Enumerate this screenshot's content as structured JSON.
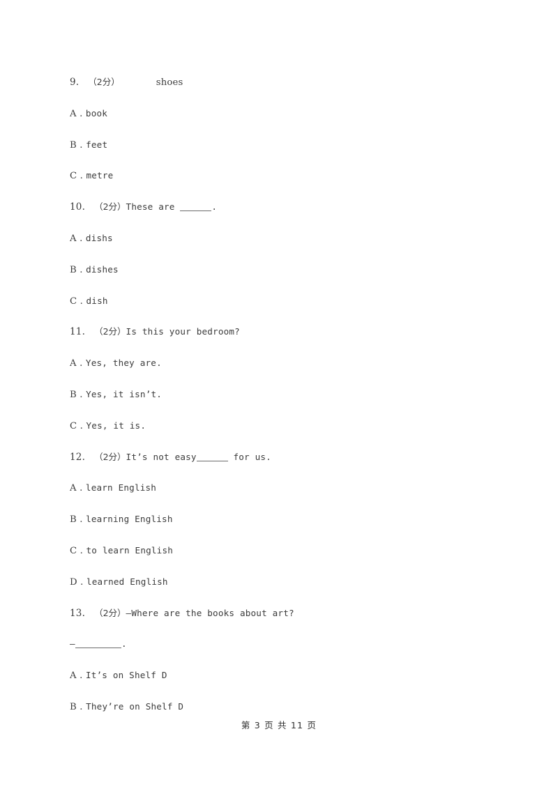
{
  "document": {
    "type": "exam-paper",
    "text_color": "#3b3b3b",
    "background_color": "#ffffff"
  },
  "questions": [
    {
      "number": "9.",
      "marks": "（2分）",
      "stem_before": "",
      "blank": "gap",
      "stem_after": "shoes",
      "options": [
        {
          "letter": "A",
          "separator": " .",
          "text": "book"
        },
        {
          "letter": "B",
          "separator": " .",
          "text": "feet"
        },
        {
          "letter": "C",
          "separator": " .",
          "text": "metre"
        }
      ]
    },
    {
      "number": "10.",
      "marks": "（2分）",
      "stem_before": "These are ",
      "blank": "underline",
      "stem_after": ".",
      "options": [
        {
          "letter": "A",
          "separator": " .",
          "text": "dishs"
        },
        {
          "letter": "B",
          "separator": " .",
          "text": "dishes"
        },
        {
          "letter": "C",
          "separator": " .",
          "text": "dish"
        }
      ]
    },
    {
      "number": "11.",
      "marks": "（2分）",
      "stem_before": "Is this your bedroom?",
      "blank": "none",
      "stem_after": "",
      "options": [
        {
          "letter": "A",
          "separator": " .",
          "text": "Yes, they are."
        },
        {
          "letter": "B",
          "separator": " .",
          "text": "Yes, it isn’t."
        },
        {
          "letter": "C",
          "separator": " .",
          "text": "Yes, it is."
        }
      ]
    },
    {
      "number": "12.",
      "marks": "（2分）",
      "stem_before": "It’s not easy",
      "blank": "underline",
      "stem_after": " for us.",
      "options": [
        {
          "letter": "A",
          "separator": " .",
          "text": "learn English"
        },
        {
          "letter": "B",
          "separator": " .",
          "text": "learning English"
        },
        {
          "letter": "C",
          "separator": " .",
          "text": "to learn English"
        },
        {
          "letter": "D",
          "separator": " .",
          "text": "learned English"
        }
      ]
    },
    {
      "number": "13.",
      "marks": "（2分）",
      "stem_before": "—Where are the books about art?",
      "blank": "none",
      "stem_after": "",
      "answer_line_dash": "—",
      "answer_line_tail": ".",
      "options": [
        {
          "letter": "A",
          "separator": " .",
          "text": "It’s on Shelf D"
        },
        {
          "letter": "B",
          "separator": " .",
          "text": "They’re on Shelf D"
        }
      ]
    }
  ],
  "footer": {
    "text": "第 3 页 共 11 页",
    "current_page": "3",
    "total_pages": "11"
  }
}
